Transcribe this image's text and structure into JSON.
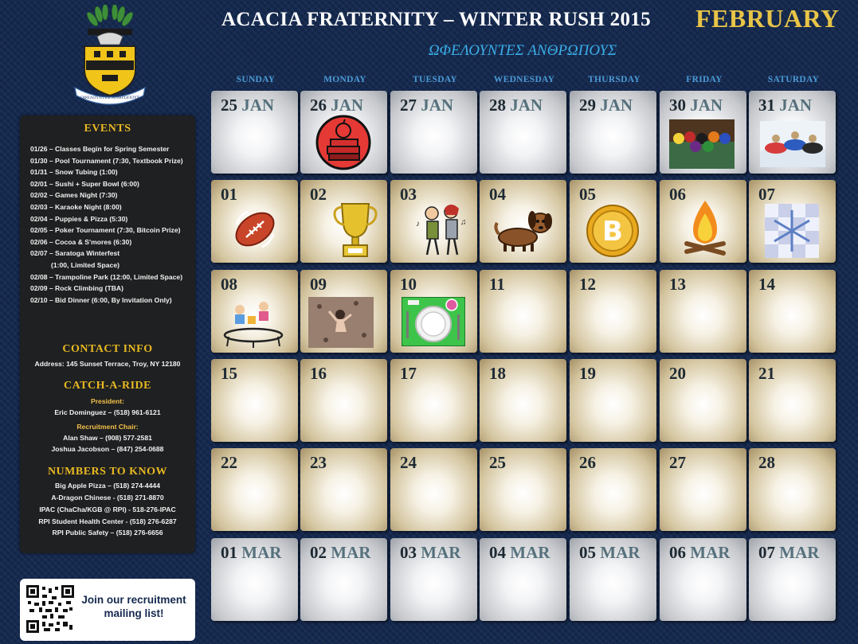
{
  "header": {
    "title": "ACACIA FRATERNITY – WINTER RUSH 2015",
    "month": "FEBRUARY",
    "motto": "ΩΦΕΛΟΥΝΤΕΣ ΑΝΘΡΩΠΟΥΣ"
  },
  "crest": {
    "icon": "acacia-crest-icon",
    "banner_text": "ΩΦΕΛΟΥΝΤΕΣ ΑΝΘΡΩΠΟΥΣ"
  },
  "day_names": [
    "SUNDAY",
    "MONDAY",
    "TUESDAY",
    "WEDNESDAY",
    "THURSDAY",
    "FRIDAY",
    "SATURDAY"
  ],
  "weeks": [
    [
      {
        "day": "25",
        "month": "JAN",
        "style": "gray"
      },
      {
        "day": "26",
        "month": "JAN",
        "style": "gray",
        "icon": "textbooks-icon"
      },
      {
        "day": "27",
        "month": "JAN",
        "style": "gray"
      },
      {
        "day": "28",
        "month": "JAN",
        "style": "gray"
      },
      {
        "day": "29",
        "month": "JAN",
        "style": "gray"
      },
      {
        "day": "30",
        "month": "JAN",
        "style": "gray",
        "icon": "pool-table-icon"
      },
      {
        "day": "31",
        "month": "JAN",
        "style": "gray",
        "icon": "snow-tubing-icon"
      }
    ],
    [
      {
        "day": "01",
        "month": "",
        "style": "tan",
        "icon": "football-icon"
      },
      {
        "day": "02",
        "month": "",
        "style": "tan",
        "icon": "trophy-icon"
      },
      {
        "day": "03",
        "month": "",
        "style": "tan",
        "icon": "karaoke-singers-icon"
      },
      {
        "day": "04",
        "month": "",
        "style": "tan",
        "icon": "puppy-icon"
      },
      {
        "day": "05",
        "month": "",
        "style": "tan",
        "icon": "bitcoin-icon"
      },
      {
        "day": "06",
        "month": "",
        "style": "tan",
        "icon": "campfire-icon"
      },
      {
        "day": "07",
        "month": "",
        "style": "tan",
        "icon": "snowflake-icon"
      }
    ],
    [
      {
        "day": "08",
        "month": "",
        "style": "tan",
        "icon": "trampoline-icon"
      },
      {
        "day": "09",
        "month": "",
        "style": "tan",
        "icon": "rock-climbing-icon"
      },
      {
        "day": "10",
        "month": "",
        "style": "tan",
        "icon": "dinner-plate-icon"
      },
      {
        "day": "11",
        "month": "",
        "style": "tan"
      },
      {
        "day": "12",
        "month": "",
        "style": "tan"
      },
      {
        "day": "13",
        "month": "",
        "style": "tan"
      },
      {
        "day": "14",
        "month": "",
        "style": "tan"
      }
    ],
    [
      {
        "day": "15",
        "month": "",
        "style": "tan"
      },
      {
        "day": "16",
        "month": "",
        "style": "tan"
      },
      {
        "day": "17",
        "month": "",
        "style": "tan"
      },
      {
        "day": "18",
        "month": "",
        "style": "tan"
      },
      {
        "day": "19",
        "month": "",
        "style": "tan"
      },
      {
        "day": "20",
        "month": "",
        "style": "tan"
      },
      {
        "day": "21",
        "month": "",
        "style": "tan"
      }
    ],
    [
      {
        "day": "22",
        "month": "",
        "style": "tan"
      },
      {
        "day": "23",
        "month": "",
        "style": "tan"
      },
      {
        "day": "24",
        "month": "",
        "style": "tan"
      },
      {
        "day": "25",
        "month": "",
        "style": "tan"
      },
      {
        "day": "26",
        "month": "",
        "style": "tan"
      },
      {
        "day": "27",
        "month": "",
        "style": "tan"
      },
      {
        "day": "28",
        "month": "",
        "style": "tan"
      }
    ],
    [
      {
        "day": "01",
        "month": "MAR",
        "style": "gray"
      },
      {
        "day": "02",
        "month": "MAR",
        "style": "gray"
      },
      {
        "day": "03",
        "month": "MAR",
        "style": "gray"
      },
      {
        "day": "04",
        "month": "MAR",
        "style": "gray"
      },
      {
        "day": "05",
        "month": "MAR",
        "style": "gray"
      },
      {
        "day": "06",
        "month": "MAR",
        "style": "gray"
      },
      {
        "day": "07",
        "month": "MAR",
        "style": "gray"
      }
    ]
  ],
  "sidebar": {
    "events_title": "EVENTS",
    "events": [
      "01/26 – Classes Begin for Spring Semester",
      "01/30 – Pool Tournament (7:30, Textbook Prize)",
      "01/31 – Snow Tubing (1:00)",
      "02/01 – Sushi + Super Bowl (6:00)",
      "02/02 – Games Night (7:30)",
      "02/03 – Karaoke Night (8:00)",
      "02/04 – Puppies & Pizza (5:30)",
      "02/05 – Poker Tournament (7:30, Bitcoin Prize)",
      "02/06 – Cocoa & S'mores (6:30)",
      "02/07 – Saratoga Winterfest",
      "(1:00, Limited Space)",
      "02/08 – Trampoline Park (12:00, Limited Space)",
      "02/09 – Rock Climbing (TBA)",
      "02/10 – Bid Dinner (6:00, By Invitation Only)"
    ],
    "contact_title": "CONTACT INFO",
    "address": "Address: 145 Sunset Terrace, Troy, NY 12180",
    "ride_title": "CATCH-A-RIDE",
    "president_label": "President:",
    "president": "Eric Dominguez – (518) 961-6121",
    "recruitment_label": "Recruitment Chair:",
    "recruitment_1": "Alan Shaw – (908) 577-2581",
    "recruitment_2": "Joshua Jacobson – (847) 254-0688",
    "numbers_title": "NUMBERS TO KNOW",
    "numbers": [
      "Big Apple Pizza – (518) 274-4444",
      "A-Dragon Chinese - (518) 271-8870",
      "IPAC (ChaCha/KGB @ RPI) - 518-276-IPAC",
      "RPI Student Health Center - (518) 276-6287",
      "RPI Public Safety – (518) 276-6656"
    ]
  },
  "qr": {
    "icon": "qr-code-icon",
    "line1": "Join our recruitment",
    "line2": "mailing list!"
  },
  "colors": {
    "background": "#15294f",
    "gold": "#e8c447",
    "motto_blue": "#3aaee8",
    "day_header_blue": "#4b9ad6",
    "sidebar_bg": "#1f2021"
  }
}
